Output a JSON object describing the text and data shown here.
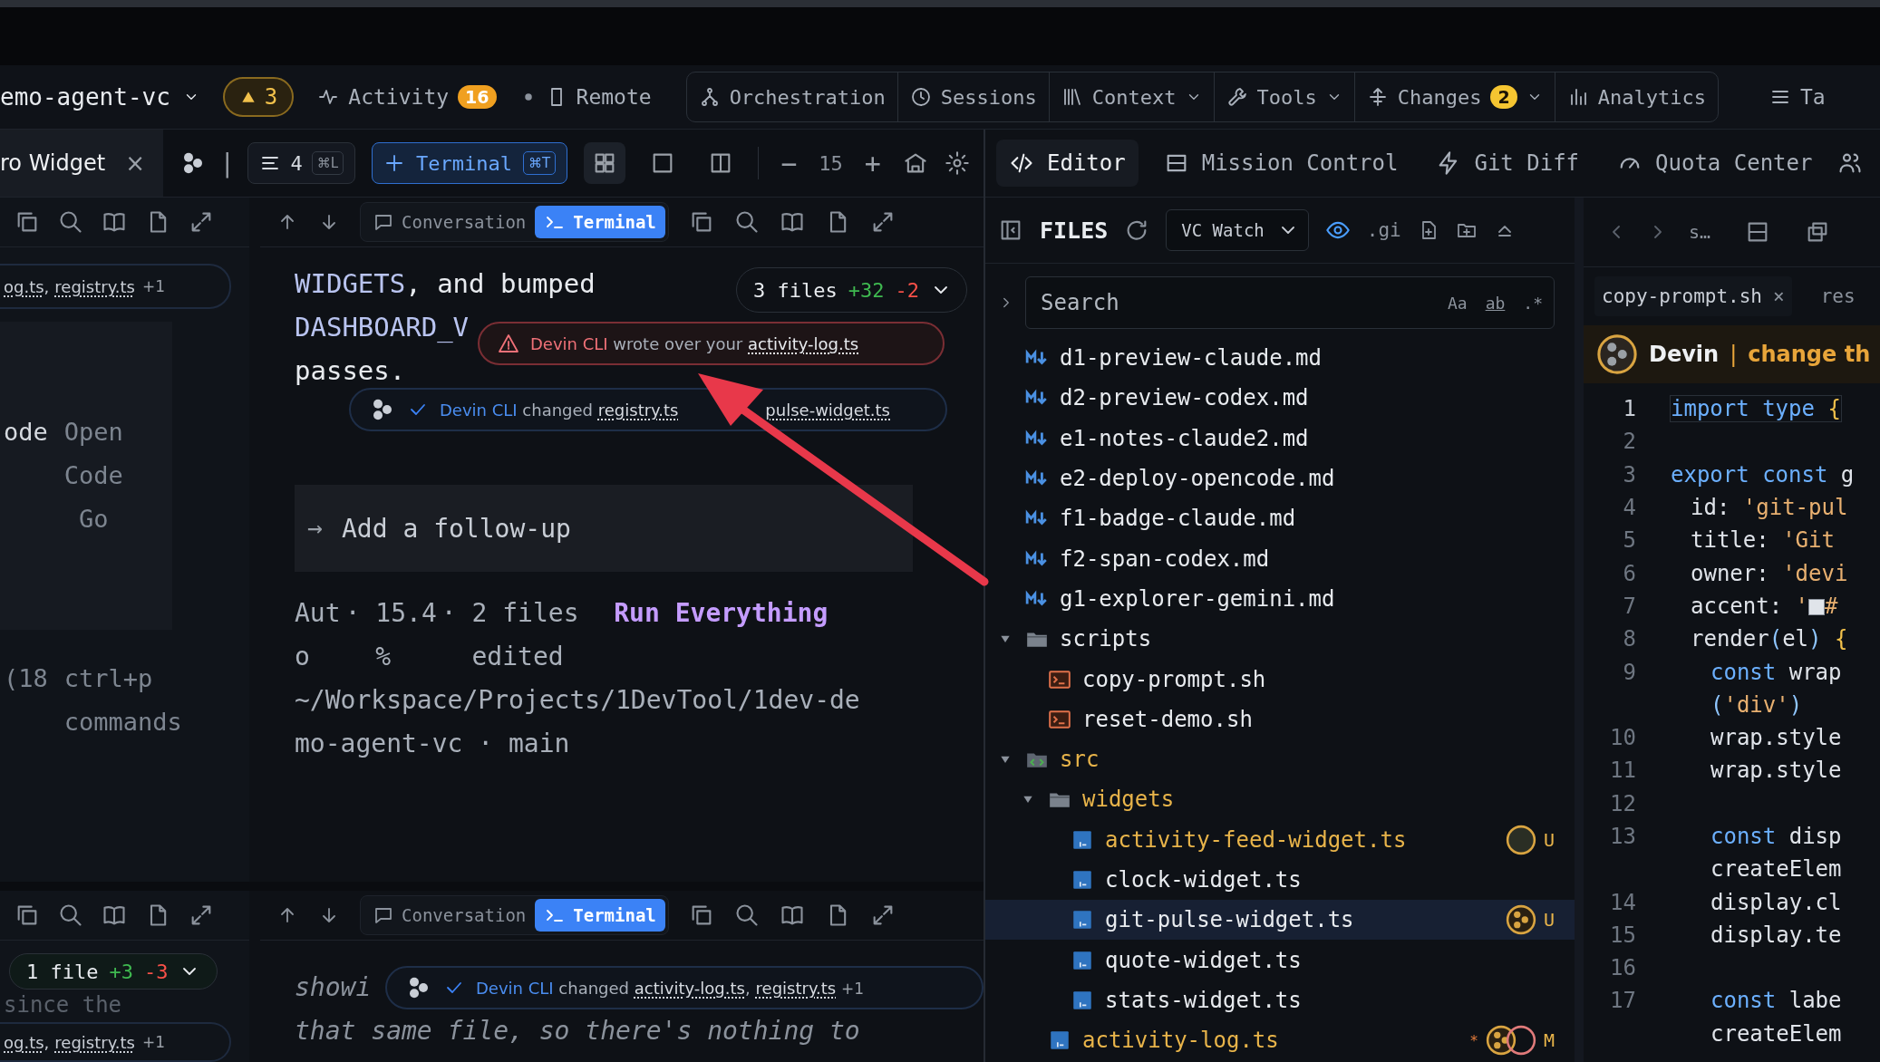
{
  "toolbar": {
    "project": "emo-agent-vc",
    "warning_count": "3",
    "activity": {
      "label": "Activity",
      "count": "16"
    },
    "remote": "Remote",
    "nav": [
      {
        "label": "Orchestration",
        "menu": false
      },
      {
        "label": "Sessions",
        "menu": false
      },
      {
        "label": "Context",
        "menu": true
      },
      {
        "label": "Tools",
        "menu": true
      },
      {
        "label": "Changes",
        "menu": true,
        "badge": "2"
      },
      {
        "label": "Analytics",
        "menu": false
      }
    ],
    "tasks": "Ta"
  },
  "session_bar": {
    "tab": "ro Widget",
    "close": "×",
    "separator": "|",
    "lines": "4",
    "lines_shortcut": "⌘L",
    "terminal": "Terminal",
    "terminal_shortcut": "⌘T",
    "layouts": [
      {
        "selected": true
      },
      {
        "selected": false
      },
      {
        "selected": false
      }
    ],
    "minus": "−",
    "font_size": "15",
    "plus": "+"
  },
  "views": [
    {
      "label": "Editor",
      "selected": true
    },
    {
      "label": "Mission Control",
      "selected": false
    },
    {
      "label": "Git Diff",
      "selected": false
    },
    {
      "label": "Quota Center",
      "selected": false
    }
  ],
  "upper": {
    "side": {
      "chip": {
        "files": [
          "og.ts",
          "registry.ts"
        ],
        "delimiter": ",",
        "more": "+1"
      },
      "commands": [
        {
          "key": "ode",
          "action": "Open Code Go"
        },
        {
          "key": "(18",
          "action": "ctrl+p commands"
        }
      ]
    },
    "pane": {
      "tabs": [
        {
          "label": "Conversation",
          "selected": false
        },
        {
          "label": "Terminal",
          "selected": true
        }
      ],
      "message": [
        [
          {
            "text": "WIDGETS",
            "code": true
          },
          {
            "text": ", and bumped",
            "code": false
          }
        ],
        [
          {
            "text": "DASHBOARD_V",
            "code": true
          }
        ],
        [
          {
            "text": "passes.",
            "code": false
          }
        ]
      ],
      "diff_chip": {
        "files": "3 files",
        "added": "+32",
        "removed": "-2"
      },
      "follow_up": {
        "arrow": "→",
        "placeholder": "Add a follow-up"
      },
      "status": [
        {
          "text": "Auto",
          "separator": "·"
        },
        {
          "text": "15.4%",
          "separator": "·"
        },
        {
          "text": "2 files edited"
        }
      ],
      "run": "Run Everything",
      "path": "~/Workspace/Projects/1DevTool/1dev-demo-agent-vc",
      "branch_separator": "·",
      "branch": "main",
      "toasts": [
        {
          "kind": "warning",
          "agent": "Devin CLI",
          "verb": "wrote over your",
          "files": [
            "activity-log.ts"
          ]
        },
        {
          "kind": "success",
          "agent": "Devin CLI",
          "verb": "changed",
          "files": [
            "registry.ts",
            "pulse-widget.ts"
          ]
        }
      ]
    }
  },
  "lower": {
    "side": {
      "diff_chip": {
        "files": "1 file",
        "added": "+3",
        "removed": "-3"
      },
      "faded": "since the",
      "chip": {
        "files": [
          "og.ts",
          "registry.ts"
        ],
        "delimiter": ",",
        "more": "+1"
      }
    },
    "pane": {
      "tabs": [
        {
          "label": "Conversation",
          "selected": false
        },
        {
          "label": "Terminal",
          "selected": true
        }
      ],
      "lines": [
        "showi",
        "that same file, so there's nothing to"
      ],
      "toast": {
        "kind": "success",
        "agent": "Devin CLI",
        "verb": "changed",
        "files": [
          "activity-log.ts",
          "registry.ts"
        ],
        "delimiter": ",",
        "more": "+1"
      }
    }
  },
  "files": {
    "title": "FILES",
    "watch": "VC Watch",
    "watching": true,
    "gitignore": ".gi",
    "search": {
      "placeholder": "Search",
      "options": [
        "Aa",
        "ab",
        ".*"
      ]
    },
    "tree": [
      {
        "name": "d1-preview-claude.md",
        "kind": "markdown",
        "changed": false,
        "selected": false
      },
      {
        "name": "d2-preview-codex.md",
        "kind": "markdown",
        "changed": false,
        "selected": false
      },
      {
        "name": "e1-notes-claude2.md",
        "kind": "markdown",
        "changed": false,
        "selected": false
      },
      {
        "name": "e2-deploy-opencode.md",
        "kind": "markdown",
        "changed": false,
        "selected": false
      },
      {
        "name": "f1-badge-claude.md",
        "kind": "markdown",
        "changed": false,
        "selected": false
      },
      {
        "name": "f2-span-codex.md",
        "kind": "markdown",
        "changed": false,
        "selected": false
      },
      {
        "name": "g1-explorer-gemini.md",
        "kind": "markdown",
        "changed": false,
        "selected": false
      },
      {
        "name": "scripts",
        "kind": "folder",
        "expanded": true,
        "changed": false,
        "selected": false,
        "children": [
          {
            "name": "copy-prompt.sh",
            "kind": "script",
            "changed": false,
            "selected": false
          },
          {
            "name": "reset-demo.sh",
            "kind": "script",
            "changed": false,
            "selected": false
          }
        ]
      },
      {
        "name": "src",
        "kind": "source",
        "expanded": true,
        "changed": true,
        "selected": false,
        "children": [
          {
            "name": "widgets",
            "kind": "folder",
            "expanded": true,
            "changed": true,
            "selected": false,
            "children": [
              {
                "name": "activity-feed-widget.ts",
                "kind": "typescript",
                "changed": true,
                "selected": false,
                "avatars": [
                  {
                    "kind": "empty"
                  }
                ],
                "status": "U"
              },
              {
                "name": "clock-widget.ts",
                "kind": "typescript",
                "changed": false,
                "selected": false
              },
              {
                "name": "git-pulse-widget.ts",
                "kind": "typescript",
                "changed": false,
                "selected": true,
                "avatars": [
                  {
                    "kind": "agent"
                  }
                ],
                "status": "U"
              },
              {
                "name": "quote-widget.ts",
                "kind": "typescript",
                "changed": false,
                "selected": false
              },
              {
                "name": "stats-widget.ts",
                "kind": "typescript",
                "changed": false,
                "selected": false
              }
            ]
          },
          {
            "name": "activity-log.ts",
            "kind": "typescript",
            "changed": true,
            "selected": false,
            "mark": "*",
            "avatars": [
              {
                "kind": "agent"
              },
              {
                "kind": "ring"
              }
            ],
            "status": "M"
          }
        ]
      }
    ]
  },
  "editor": {
    "nav": "s…",
    "tabs": [
      {
        "label": "copy-prompt.sh",
        "close": "×",
        "selected": true
      },
      {
        "label": "res",
        "selected": false
      }
    ],
    "banner": {
      "agent": "Devin",
      "separator": "|",
      "message": "change th"
    },
    "lines": [
      {
        "n": "1",
        "kind": "top",
        "tokens": [
          {
            "kind": "keyword",
            "text": "import type"
          },
          {
            "kind": "brace",
            "text": " {"
          }
        ]
      },
      {
        "n": "2"
      },
      {
        "n": "3",
        "kind": "top",
        "tokens": [
          {
            "kind": "keyword",
            "text": "export const"
          },
          {
            "kind": "plain",
            "text": " g"
          }
        ]
      },
      {
        "n": "4",
        "kind": "object",
        "tokens": [
          {
            "kind": "plain",
            "text": "id: "
          },
          {
            "kind": "string",
            "text": "'git-pul"
          }
        ]
      },
      {
        "n": "5",
        "kind": "object",
        "tokens": [
          {
            "kind": "plain",
            "text": "title: "
          },
          {
            "kind": "string",
            "text": "'Git"
          }
        ]
      },
      {
        "n": "6",
        "kind": "object",
        "tokens": [
          {
            "kind": "plain",
            "text": "owner: "
          },
          {
            "kind": "string",
            "text": "'devi"
          }
        ]
      },
      {
        "n": "7",
        "kind": "object",
        "tokens": [
          {
            "kind": "plain",
            "text": "accent: "
          },
          {
            "kind": "string",
            "text": "'"
          },
          {
            "kind": "swatch"
          },
          {
            "kind": "string",
            "text": "#"
          }
        ]
      },
      {
        "n": "8",
        "kind": "object",
        "tokens": [
          {
            "kind": "plain",
            "text": "render"
          },
          {
            "kind": "paren",
            "text": "("
          },
          {
            "kind": "plain",
            "text": "el"
          },
          {
            "kind": "paren",
            "text": ")"
          },
          {
            "kind": "brace",
            "text": " {"
          }
        ]
      },
      {
        "n": "9",
        "kind": "body",
        "tokens": [
          {
            "kind": "keyword",
            "text": "const"
          },
          {
            "kind": "plain",
            "text": " wrap"
          }
        ]
      },
      {
        "kind": "body",
        "tokens": [
          {
            "kind": "paren",
            "text": "("
          },
          {
            "kind": "string",
            "text": "'div'"
          },
          {
            "kind": "paren",
            "text": ")"
          }
        ]
      },
      {
        "n": "10",
        "kind": "body",
        "tokens": [
          {
            "kind": "plain",
            "text": "wrap.style"
          }
        ]
      },
      {
        "n": "11",
        "kind": "body",
        "tokens": [
          {
            "kind": "plain",
            "text": "wrap.style"
          }
        ]
      },
      {
        "n": "12"
      },
      {
        "n": "13",
        "kind": "body",
        "tokens": [
          {
            "kind": "keyword",
            "text": "const"
          },
          {
            "kind": "plain",
            "text": " disp"
          }
        ]
      },
      {
        "kind": "body",
        "tokens": [
          {
            "kind": "plain",
            "text": "createElem"
          }
        ]
      },
      {
        "n": "14",
        "kind": "body",
        "tokens": [
          {
            "kind": "plain",
            "text": "display.cl"
          }
        ]
      },
      {
        "n": "15",
        "kind": "body",
        "tokens": [
          {
            "kind": "plain",
            "text": "display.te"
          }
        ]
      },
      {
        "n": "16"
      },
      {
        "n": "17",
        "kind": "body",
        "tokens": [
          {
            "kind": "keyword",
            "text": "const"
          },
          {
            "kind": "plain",
            "text": " labe"
          }
        ]
      },
      {
        "kind": "body",
        "tokens": [
          {
            "kind": "plain",
            "text": "createElem"
          }
        ]
      }
    ]
  }
}
